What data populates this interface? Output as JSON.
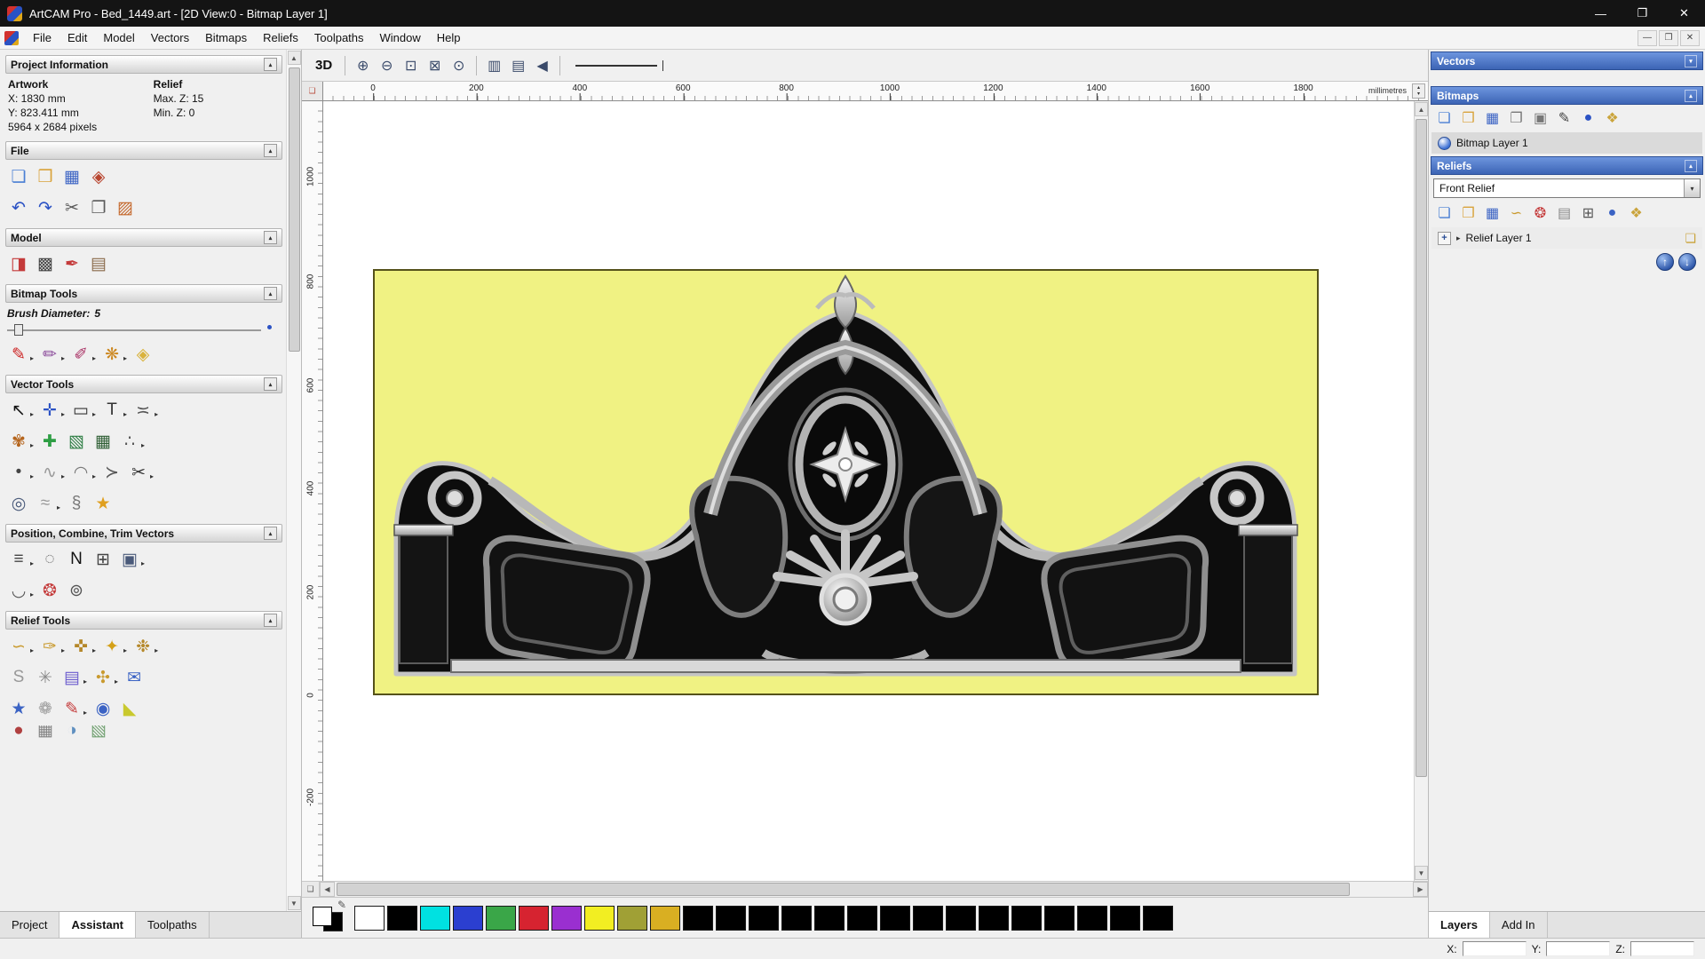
{
  "window": {
    "title": "ArtCAM Pro - Bed_1449.art - [2D View:0 - Bitmap Layer 1]"
  },
  "titlebar": {
    "minimize": "—",
    "maximize": "❐",
    "close": "✕"
  },
  "menu": {
    "items": [
      "File",
      "Edit",
      "Model",
      "Vectors",
      "Bitmaps",
      "Reliefs",
      "Toolpaths",
      "Window",
      "Help"
    ],
    "child_controls": {
      "minimize": "—",
      "restore": "❐",
      "close": "✕"
    }
  },
  "icons": {
    "flyout": "▸",
    "collapse_up": "▴",
    "collapse_down": "▾",
    "arrow_up": "▲",
    "arrow_down": "▼",
    "arrow_left": "◀",
    "arrow_right": "▶",
    "expander": "▸",
    "pencil": "✎",
    "move_up": "↑",
    "move_down": "↓",
    "page": "❏",
    "spin_up": "▴",
    "spin_down": "▾",
    "plus": "+"
  },
  "left_panel": {
    "project_information": {
      "title": "Project Information",
      "artwork_header": "Artwork",
      "relief_header": "Relief",
      "artwork_x": "X: 1830 mm",
      "artwork_y": "Y: 823.411 mm",
      "artwork_pixels": "5964 x 2684 pixels",
      "relief_max_z": "Max. Z: 15",
      "relief_min_z": "Min. Z: 0"
    },
    "file": {
      "title": "File",
      "row1": [
        {
          "name": "new-model",
          "glyph": "❏",
          "color": "#4a7fd4"
        },
        {
          "name": "open-model",
          "glyph": "❒",
          "color": "#d9a33c"
        },
        {
          "name": "save-model",
          "glyph": "▦",
          "color": "#3b63c4"
        },
        {
          "name": "export-model",
          "glyph": "◈",
          "color": "#b8452f"
        }
      ],
      "row2": [
        {
          "name": "undo",
          "glyph": "↶",
          "color": "#2b52c4"
        },
        {
          "name": "redo",
          "glyph": "↷",
          "color": "#2b52c4"
        },
        {
          "name": "cut",
          "glyph": "✂",
          "color": "#5a5a5a"
        },
        {
          "name": "copy",
          "glyph": "❐",
          "color": "#5a5a5a"
        },
        {
          "name": "paste",
          "glyph": "▨",
          "color": "#c4672b"
        }
      ]
    },
    "model": {
      "title": "Model",
      "row": [
        {
          "name": "set-model-size",
          "glyph": "◨",
          "color": "#c43a3a"
        },
        {
          "name": "greyscale-preview",
          "glyph": "▩",
          "color": "#444444"
        },
        {
          "name": "sculpt-model",
          "glyph": "✒",
          "color": "#c43a3a"
        },
        {
          "name": "model-from-image",
          "glyph": "▤",
          "color": "#8a6a4a"
        }
      ]
    },
    "bitmap_tools": {
      "title": "Bitmap Tools",
      "brush_label": "Brush Diameter:",
      "brush_value": "5",
      "row": [
        {
          "name": "paint-brush",
          "glyph": "✎",
          "color": "#cc2222",
          "arrow": true
        },
        {
          "name": "paint-selective",
          "glyph": "✏",
          "color": "#8a4a9a",
          "arrow": true
        },
        {
          "name": "colour-picker",
          "glyph": "✐",
          "color": "#aa3366",
          "arrow": true
        },
        {
          "name": "colour-palette",
          "glyph": "❋",
          "color": "#cc8822",
          "arrow": true
        },
        {
          "name": "flood-fill",
          "glyph": "◈",
          "color": "#d9b23c"
        }
      ]
    },
    "vector_tools": {
      "title": "Vector Tools",
      "row1": [
        {
          "name": "select-vectors",
          "glyph": "↖",
          "color": "#111111",
          "arrow": true
        },
        {
          "name": "transform-vectors",
          "glyph": "✛",
          "color": "#2b52c4",
          "arrow": true
        },
        {
          "name": "create-rectangle",
          "glyph": "▭",
          "color": "#333333",
          "arrow": true
        },
        {
          "name": "create-text",
          "glyph": "T",
          "color": "#333333",
          "arrow": true
        },
        {
          "name": "measure-tool",
          "glyph": "≍",
          "color": "#555555",
          "arrow": true
        }
      ],
      "row2": [
        {
          "name": "offset-vectors",
          "glyph": "✾",
          "color": "#b5651d",
          "arrow": true
        },
        {
          "name": "block-copy",
          "glyph": "✚",
          "color": "#2e9e44"
        },
        {
          "name": "text-on-curve",
          "glyph": "▧",
          "color": "#2e7e44"
        },
        {
          "name": "paste-array",
          "glyph": "▦",
          "color": "#2e5e34"
        },
        {
          "name": "bridge-vectors",
          "glyph": "∴",
          "color": "#555555",
          "arrow": true
        }
      ],
      "row3": [
        {
          "name": "create-dot",
          "glyph": "•",
          "color": "#444444",
          "arrow": true
        },
        {
          "name": "freehand-sketch",
          "glyph": "∿",
          "color": "#999999",
          "arrow": true
        },
        {
          "name": "create-spline",
          "glyph": "◠",
          "color": "#777777",
          "arrow": true
        },
        {
          "name": "create-polyline",
          "glyph": "≻",
          "color": "#555555"
        },
        {
          "name": "trim-vectors",
          "glyph": "✂",
          "color": "#333333",
          "arrow": true
        }
      ],
      "row4": [
        {
          "name": "ring-tool",
          "glyph": "◎",
          "color": "#4a5a7a"
        },
        {
          "name": "wave-tool",
          "glyph": "≈",
          "color": "#999999",
          "arrow": true
        },
        {
          "name": "profile-tool",
          "glyph": "§",
          "color": "#777777"
        },
        {
          "name": "create-star",
          "glyph": "★",
          "color": "#e0a020"
        }
      ]
    },
    "position_tools": {
      "title": "Position, Combine, Trim Vectors",
      "row1": [
        {
          "name": "align-vectors",
          "glyph": "≡",
          "color": "#444444",
          "arrow": true
        },
        {
          "name": "circular-array",
          "glyph": "◌",
          "color": "#555555"
        },
        {
          "name": "nesting",
          "glyph": "N",
          "color": "#111111"
        },
        {
          "name": "block-array",
          "glyph": "⊞",
          "color": "#444444"
        },
        {
          "name": "merge-vectors",
          "glyph": "▣",
          "color": "#4a5a7a",
          "arrow": true
        }
      ],
      "row2": [
        {
          "name": "join-vectors",
          "glyph": "◡",
          "color": "#555555",
          "arrow": true
        },
        {
          "name": "weld-vectors",
          "glyph": "❂",
          "color": "#c43a3a"
        },
        {
          "name": "slice-vectors",
          "glyph": "⊚",
          "color": "#555555"
        }
      ]
    },
    "relief_tools": {
      "title": "Relief Tools",
      "row1": [
        {
          "name": "smooth-relief",
          "glyph": "∽",
          "color": "#c99a2e",
          "arrow": true
        },
        {
          "name": "sculpt-relief",
          "glyph": "✑",
          "color": "#c99a2e",
          "arrow": true
        },
        {
          "name": "dynamic-sculpt",
          "glyph": "✜",
          "color": "#b5882a",
          "arrow": true
        },
        {
          "name": "shape-editor",
          "glyph": "✦",
          "color": "#d4a017",
          "arrow": true
        },
        {
          "name": "texture-relief",
          "glyph": "❉",
          "color": "#b5882a",
          "arrow": true
        }
      ],
      "row2": [
        {
          "name": "smoothing-tool",
          "glyph": "S",
          "color": "#999999"
        },
        {
          "name": "weave-wizard",
          "glyph": "✳",
          "color": "#8a8a8a"
        },
        {
          "name": "relief-clipart",
          "glyph": "▤",
          "color": "#6a5acd",
          "arrow": true
        },
        {
          "name": "two-rail-sweep",
          "glyph": "✣",
          "color": "#c99a2e",
          "arrow": true
        },
        {
          "name": "envelope-distort",
          "glyph": "✉",
          "color": "#3b63c4"
        }
      ],
      "row3": [
        {
          "name": "star-wizard",
          "glyph": "★",
          "color": "#3b63c4"
        },
        {
          "name": "swirl-texture",
          "glyph": "❁",
          "color": "#999999"
        },
        {
          "name": "paint-relief",
          "glyph": "✎",
          "color": "#c43a3a",
          "arrow": true
        },
        {
          "name": "texture-ball",
          "glyph": "◉",
          "color": "#3b63c4"
        },
        {
          "name": "extrude-wedge",
          "glyph": "◣",
          "color": "#c9c92e"
        }
      ],
      "row4": [
        {
          "name": "clipped-tool-1",
          "glyph": "●",
          "color": "#b04040"
        },
        {
          "name": "clipped-tool-2",
          "glyph": "▦",
          "color": "#808080"
        },
        {
          "name": "clipped-tool-3",
          "glyph": "◑",
          "color": "#6090c0"
        },
        {
          "name": "clipped-tool-4",
          "glyph": "▧",
          "color": "#70a070"
        }
      ]
    },
    "tabs": [
      {
        "label": "Project"
      },
      {
        "label": "Assistant"
      },
      {
        "label": "Toolpaths"
      }
    ]
  },
  "canvas_toolbar": {
    "view3d_label": "3D",
    "zoom_icons": [
      {
        "name": "zoom-in",
        "glyph": "⊕",
        "color": "#3a4a6a"
      },
      {
        "name": "zoom-out",
        "glyph": "⊖",
        "color": "#3a4a6a"
      },
      {
        "name": "zoom-window",
        "glyph": "⊡",
        "color": "#3a4a6a"
      },
      {
        "name": "zoom-fit",
        "glyph": "⊠",
        "color": "#3a4a6a"
      },
      {
        "name": "zoom-previous",
        "glyph": "⊙",
        "color": "#3a4a6a"
      }
    ],
    "view_icons": [
      {
        "name": "toggle-origin",
        "glyph": "▥",
        "color": "#3a4a6a"
      },
      {
        "name": "toggle-guides",
        "glyph": "▤",
        "color": "#3a4a6a"
      },
      {
        "name": "refresh-view",
        "glyph": "◀",
        "color": "#3a4a6a"
      }
    ]
  },
  "ruler": {
    "h_labels": [
      "0",
      "200",
      "400",
      "600",
      "800",
      "1000",
      "1200",
      "1400",
      "1600",
      "1800"
    ],
    "v_labels": [
      "1000",
      "800",
      "600",
      "400",
      "200",
      "0",
      "-200"
    ],
    "unit": "millimetres"
  },
  "right_panel": {
    "vectors": {
      "title": "Vectors"
    },
    "bitmaps": {
      "title": "Bitmaps",
      "layer_label": "Bitmap Layer 1",
      "icons": [
        {
          "name": "new-bitmap-layer",
          "glyph": "❏",
          "color": "#4a7fd4"
        },
        {
          "name": "open-bitmap",
          "glyph": "❒",
          "color": "#d9a33c"
        },
        {
          "name": "save-bitmap",
          "glyph": "▦",
          "color": "#3b63c4"
        },
        {
          "name": "duplicate-bitmap-layer",
          "glyph": "❐",
          "color": "#777777"
        },
        {
          "name": "merge-bitmap-layers",
          "glyph": "▣",
          "color": "#777777"
        },
        {
          "name": "rename-bitmap-layer",
          "glyph": "✎",
          "color": "#444444"
        },
        {
          "name": "bitmap-colour",
          "glyph": "●",
          "color": "#2b52c4"
        },
        {
          "name": "add-bitmap-colour",
          "glyph": "❖",
          "color": "#caa43c"
        }
      ]
    },
    "reliefs": {
      "title": "Reliefs",
      "combo_value": "Front Relief",
      "layer_label": "Relief Layer 1",
      "icons": [
        {
          "name": "new-relief-layer",
          "glyph": "❏",
          "color": "#4a7fd4"
        },
        {
          "name": "open-relief",
          "glyph": "❒",
          "color": "#d9a33c"
        },
        {
          "name": "save-relief",
          "glyph": "▦",
          "color": "#3b63c4"
        },
        {
          "name": "transfer-relief",
          "glyph": "∽",
          "color": "#c99a2e"
        },
        {
          "name": "combine-relief",
          "glyph": "❂",
          "color": "#c43a3a"
        },
        {
          "name": "relief-greyscale",
          "glyph": "▤",
          "color": "#888888"
        },
        {
          "name": "calculate-relief",
          "glyph": "⊞",
          "color": "#555555"
        },
        {
          "name": "preview-relief",
          "glyph": "●",
          "color": "#3b63c4"
        },
        {
          "name": "relief-colour",
          "glyph": "❖",
          "color": "#caa43c"
        }
      ]
    },
    "tabs": [
      {
        "label": "Layers"
      },
      {
        "label": "Add In"
      }
    ]
  },
  "palette": {
    "colors": [
      "#ffffff",
      "#000000",
      "#00e1e1",
      "#2b3fd0",
      "#3aa648",
      "#d62330",
      "#9a2fd0",
      "#f2ee22",
      "#a0a035",
      "#d9af22",
      "#000000",
      "#000000",
      "#000000",
      "#000000",
      "#000000",
      "#000000",
      "#000000",
      "#000000",
      "#000000",
      "#000000",
      "#000000",
      "#000000",
      "#000000",
      "#000000",
      "#000000"
    ]
  },
  "statusbar": {
    "x_label": "X:",
    "y_label": "Y:",
    "z_label": "Z:"
  },
  "colors": {
    "artwork_background": "#f0f283",
    "panel_header_blue": "#3c64b5"
  }
}
